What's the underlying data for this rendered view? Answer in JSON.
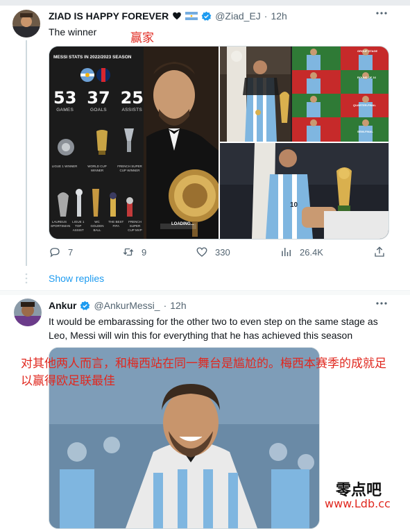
{
  "tweet1": {
    "display_name": "ZIAD IS HAPPY FOREVER",
    "handle": "@Ziad_EJ",
    "separator": "·",
    "time": "12h",
    "text": "The winner",
    "annotation": "赢家",
    "more_icon": "more-dots-icon",
    "image": {
      "title": "MESSI STATS IN 2022/2023 SEASON",
      "stats": [
        {
          "value": "53",
          "label": "GAMES"
        },
        {
          "value": "37",
          "label": "GOALS"
        },
        {
          "value": "25",
          "label": "ASSISTS"
        }
      ],
      "trophies_top": [
        "LIGUE 1 WINNER",
        "WORLD CUP WINNER",
        "FRENCH SUPER CUP WINNER"
      ],
      "trophies_bottom": [
        "LAUREUS SPORTSMAN",
        "LIGUE 1 TOP ASSIST",
        "WC GOLDEN BALL",
        "THE BEST FIFA",
        "FRENCH SUPER CUP MVP"
      ],
      "loading": "LOADING...",
      "bracket": [
        "GROUP STAGE",
        "ROUND OF 16",
        "QUARTER-FINAL",
        "SEMI-FINAL"
      ],
      "jersey_number": "10"
    },
    "actions": {
      "reply": "7",
      "retweet": "9",
      "like": "330",
      "views": "26.4K"
    }
  },
  "show_replies": "Show replies",
  "tweet2": {
    "display_name": "Ankur",
    "handle": "@AnkurMessi_",
    "separator": "·",
    "time": "12h",
    "text": "It would be embarassing for the other two to even step on the same stage as Leo, Messi will win this for everything that he has achieved this season",
    "annotation": "对其他两人而言，和梅西站在同一舞台是尴尬的。梅西本赛季的成就足以赢得欧足联最佳"
  },
  "watermark": {
    "line1": "零点吧",
    "line2": "www.Ldb.cc"
  },
  "colors": {
    "accent": "#1d9bf0",
    "annotation": "#e0281f",
    "muted": "#536471"
  }
}
